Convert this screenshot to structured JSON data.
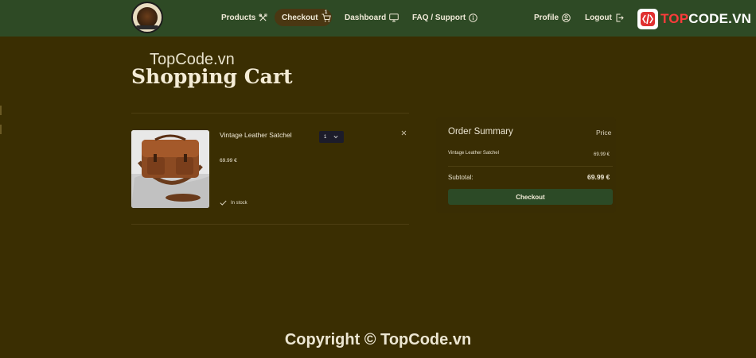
{
  "nav": {
    "products": "Products",
    "checkout": "Checkout",
    "cart_count": "1",
    "dashboard": "Dashboard",
    "faq": "FAQ / Support",
    "profile": "Profile",
    "logout": "Logout"
  },
  "brand": {
    "prefix": "TOP",
    "suffix": "CODE.VN"
  },
  "watermark": "TopCode.vn",
  "page": {
    "title": "Shopping Cart"
  },
  "cart": {
    "item": {
      "name": "Vintage Leather Satchel",
      "quantity": "1",
      "price": "69.99 €",
      "stock": "In stock"
    }
  },
  "summary": {
    "title": "Order Summary",
    "price_header": "Price",
    "items": [
      {
        "name": "Vintage Leather Satchel",
        "price": "69.99 €"
      }
    ],
    "subtotal_label": "Subtotal:",
    "subtotal_value": "69.99 €",
    "checkout_label": "Checkout"
  },
  "copyright": "Copyright © TopCode.vn",
  "colors": {
    "background": "#3a2e02",
    "navbar": "#2e4a25",
    "button": "#2c4a26",
    "brand_accent": "#ff3b3b"
  },
  "icons": [
    "tools-icon",
    "cart-icon",
    "monitor-icon",
    "info-icon",
    "user-icon",
    "logout-icon",
    "chevron-down-icon",
    "close-icon",
    "check-icon"
  ]
}
